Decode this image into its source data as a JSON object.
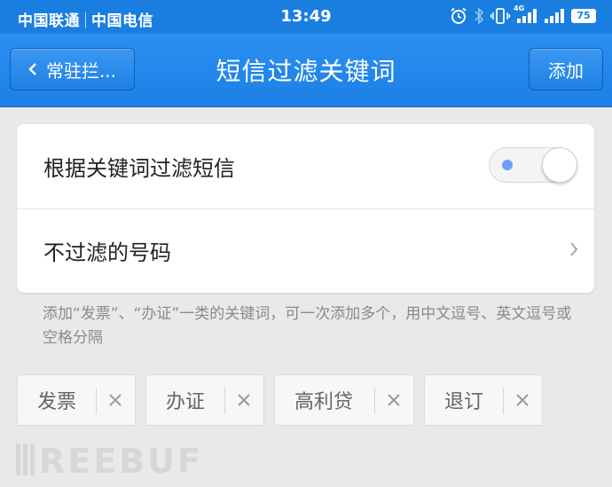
{
  "status_bar": {
    "carrier_1": "中国联通",
    "carrier_2": "中国电信",
    "time": "13:49",
    "network_label": "4G",
    "battery": "75",
    "icons": [
      "alarm-icon",
      "bluetooth-icon",
      "vibrate-icon",
      "signal-icon",
      "signal-icon",
      "battery-icon"
    ]
  },
  "nav": {
    "back_label": "常驻拦...",
    "title": "短信过滤关键词",
    "add_label": "添加"
  },
  "settings": {
    "filter_by_keyword": {
      "label": "根据关键词过滤短信",
      "enabled": true
    },
    "whitelist": {
      "label": "不过滤的号码"
    }
  },
  "hint": "添加“发票”、“办证”一类的关键词，可一次添加多个，用中文逗号、英文逗号或空格分隔",
  "keywords": [
    {
      "label": "发票"
    },
    {
      "label": "办证"
    },
    {
      "label": "高利贷"
    },
    {
      "label": "退订"
    }
  ],
  "watermark": "REEBUF",
  "colors": {
    "status_bar": "#1a7ee0",
    "nav_bar": "#2b8ff2",
    "background": "#e9e9e9",
    "card": "#ffffff",
    "toggle_dot": "#6f9df5"
  }
}
